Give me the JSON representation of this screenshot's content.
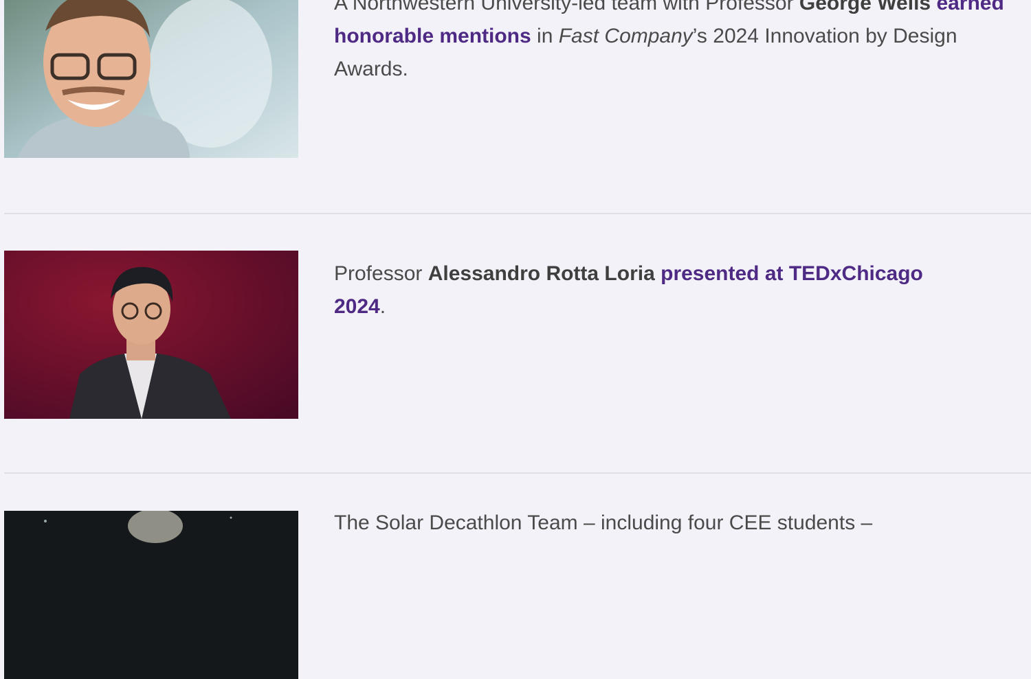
{
  "items": [
    {
      "photo_alt": "Portrait of George Wells",
      "text_pre": "A Northwestern University-led team with Professor ",
      "person": "George Wells",
      "link": "earned honorable mentions",
      "text_mid": " in ",
      "publication": "Fast Company",
      "text_post": "’s 2024 Innovation by Design Awards."
    },
    {
      "photo_alt": "Alessandro Rotta Loria speaking on stage",
      "text_pre": "Professor ",
      "person": "Alessandro Rotta Loria",
      "link": "presented at TEDxChicago 2024",
      "text_post": "."
    },
    {
      "photo_alt": "Solar Decathlon Team photo",
      "text_pre": "The Solar Decathlon Team – including four CEE students –"
    }
  ]
}
